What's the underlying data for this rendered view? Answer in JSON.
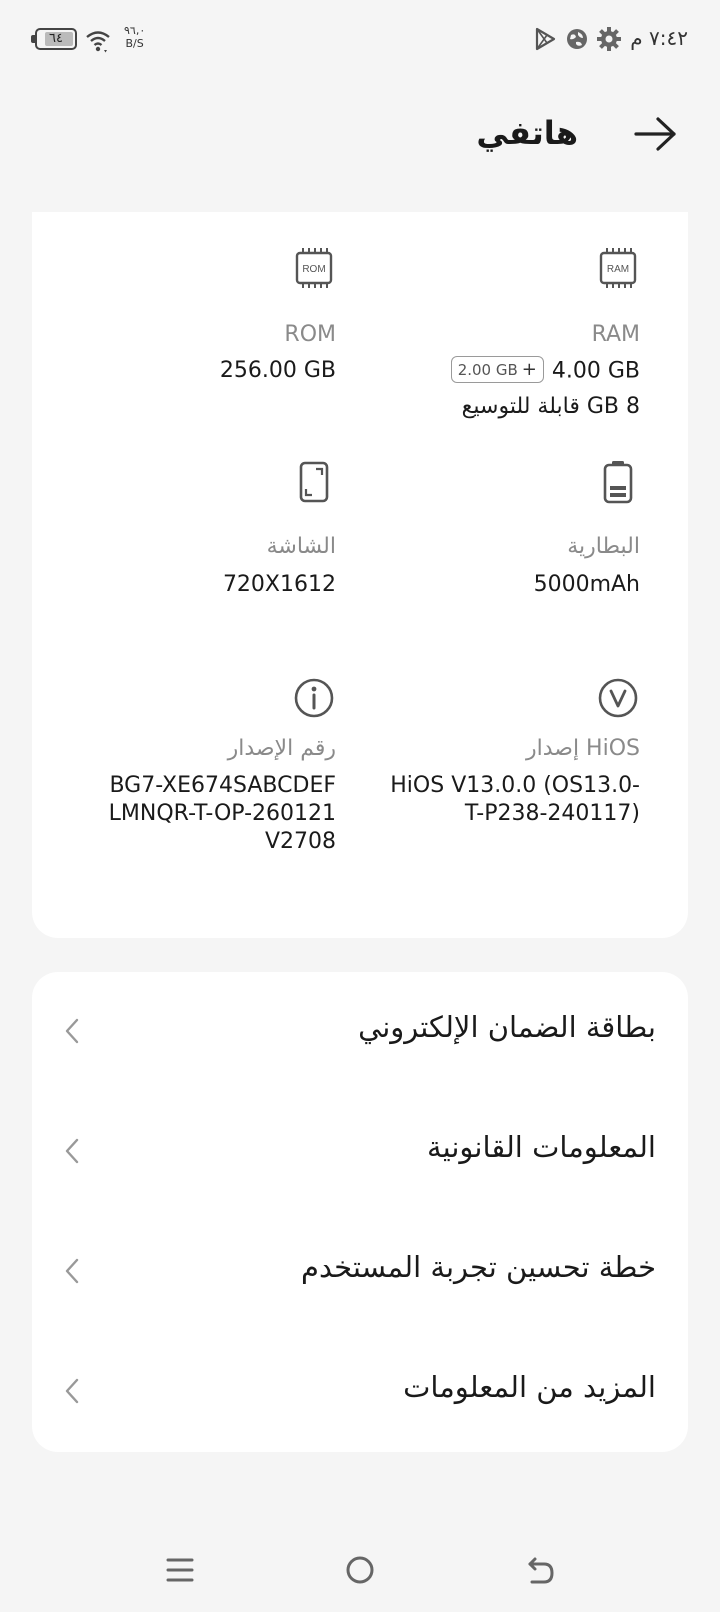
{
  "status_bar": {
    "time": "٧:٤٢ م",
    "battery_level": "٦٤",
    "net_speed": "٩٦,٠",
    "net_unit": "B/S"
  },
  "header": {
    "title": "هاتفي"
  },
  "specs": {
    "ram": {
      "icon_text": "RAM",
      "label": "RAM",
      "value": "4.00 GB",
      "extra_chip": "2.00 GB",
      "extra_plus": "+",
      "expandable": "8 GB قابلة للتوسيع"
    },
    "rom": {
      "icon_text": "ROM",
      "label": "ROM",
      "value": "256.00 GB"
    },
    "battery": {
      "label": "البطارية",
      "value": "5000mAh"
    },
    "screen": {
      "label": "الشاشة",
      "value": "720X1612"
    },
    "hios": {
      "label": "إصدار HiOS",
      "value": "HiOS V13.0.0 (OS13.0-T-P238-240117)"
    },
    "build": {
      "label": "رقم الإصدار",
      "value": "BG7-XE674SABCDEFLMNQR-T-OP-260121V2708"
    }
  },
  "menu": [
    {
      "label": "بطاقة الضمان الإلكتروني"
    },
    {
      "label": "المعلومات القانونية"
    },
    {
      "label": "خطة تحسين تجربة المستخدم"
    },
    {
      "label": "المزيد من المعلومات"
    }
  ],
  "icons": {
    "back": "arrow-right-icon",
    "chevron": "chevron-left-icon",
    "nav_menu": "menu-lines-icon",
    "nav_home": "home-circle-icon",
    "nav_back": "back-arrow-icon"
  }
}
